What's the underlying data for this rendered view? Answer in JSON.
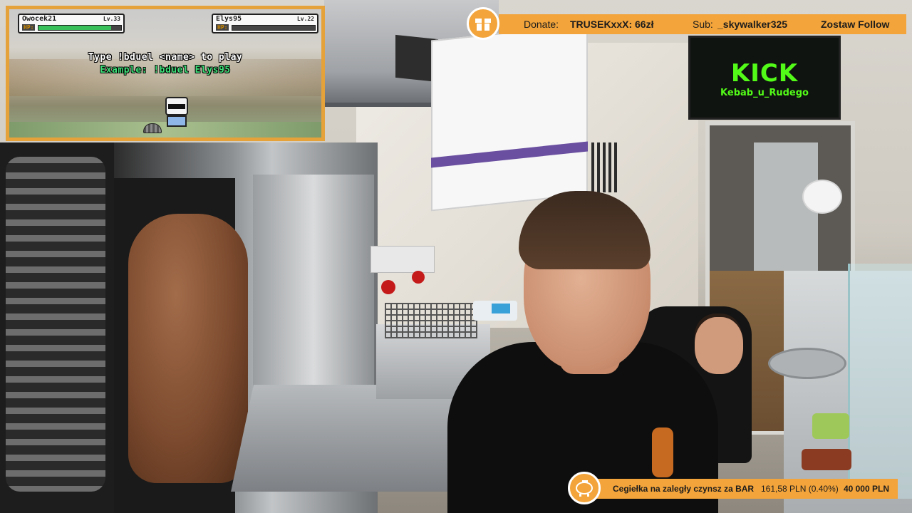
{
  "game": {
    "player_left": {
      "name": "Owocek21",
      "level": "Lv.33",
      "hp_label": "HP:",
      "hp_fraction": 0.88
    },
    "player_right": {
      "name": "Elys95",
      "level": "Lv.22",
      "hp_label": "HP:",
      "hp_fraction": 0.0
    },
    "prompt": "Type !bduel <name> to play",
    "example": "Example: !bduel Elys95"
  },
  "scene": {
    "tv_logo": "KICK",
    "tv_channel": "Kebab_u_Rudego"
  },
  "topbar": {
    "donate_label": "Donate:",
    "donate_value": "TRUSEKxxX: 66zł",
    "sub_label": "Sub:",
    "sub_value": "_skywalker325",
    "follow_label": "Zostaw Follow",
    "icon": "gift-icon",
    "color": "#f3a43a"
  },
  "goal": {
    "title": "Cegiełka na zaległy czynsz za BAR",
    "progress": "161,58 PLN (0.40%)",
    "target": "40 000 PLN",
    "progress_fraction": 0.004,
    "icon": "piggy-bank-icon"
  },
  "colors": {
    "accent": "#f3a43a",
    "kick_green": "#53fc18",
    "hp_green": "#38c05a"
  }
}
